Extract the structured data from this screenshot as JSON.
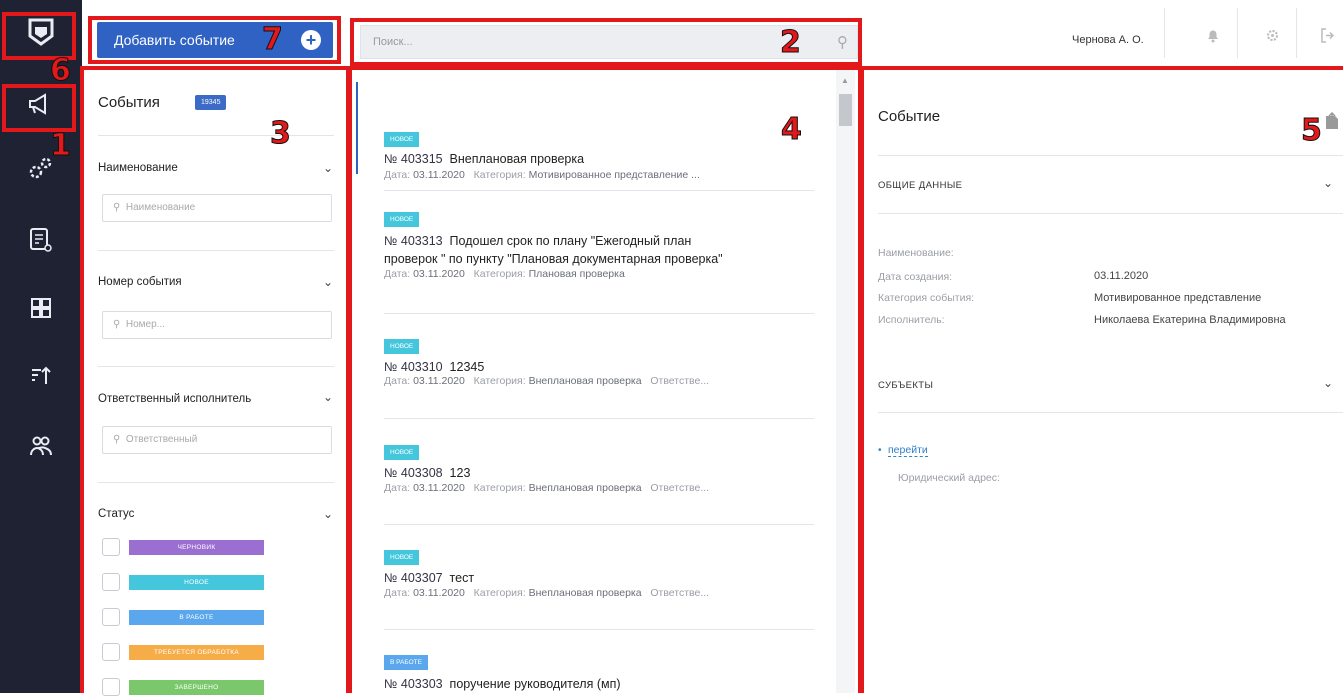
{
  "header": {
    "add_event_label": "Добавить событие",
    "search_placeholder": "Поиск...",
    "user_name": "Чернова А. О."
  },
  "sidebar": {
    "icons": [
      "logo-icon",
      "megaphone-icon",
      "gears-icon",
      "report-icon",
      "grid-icon",
      "sort-icon",
      "users-icon"
    ]
  },
  "filters": {
    "title": "События",
    "count": "19345",
    "name_label": "Наименование",
    "name_placeholder": "Наименование",
    "number_label": "Номер события",
    "number_placeholder": "Номер...",
    "responsible_label": "Ответственный исполнитель",
    "responsible_placeholder": "Ответственный",
    "status_label": "Статус",
    "statuses": [
      {
        "label": "ЧЕРНОВИК",
        "color": "#9b6fd1"
      },
      {
        "label": "НОВОЕ",
        "color": "#44c7dc"
      },
      {
        "label": "В РАБОТЕ",
        "color": "#5aa7ee"
      },
      {
        "label": "ТРЕБУЕТСЯ ОБРАБОТКА",
        "color": "#f6ad47"
      },
      {
        "label": "ЗАВЕРШЕНО",
        "color": "#7bc86c"
      }
    ]
  },
  "events": [
    {
      "badge": "НОВОЕ",
      "badge_color": "#44c7dc",
      "number": "№ 403315",
      "title": "Внеплановая проверка",
      "title2": "",
      "date_label": "Дата:",
      "date": "03.11.2020",
      "cat_label": "Категория:",
      "category": "Мотивированное представление ...",
      "extra": ""
    },
    {
      "badge": "НОВОЕ",
      "badge_color": "#44c7dc",
      "number": "№ 403313",
      "title": "Подошел срок по плану \"Ежегодный план",
      "title2": "проверок \" по пункту \"Плановая документарная проверка\"",
      "date_label": "Дата:",
      "date": "03.11.2020",
      "cat_label": "Категория:",
      "category": "Плановая проверка",
      "extra": ""
    },
    {
      "badge": "НОВОЕ",
      "badge_color": "#44c7dc",
      "number": "№ 403310",
      "title": "12345",
      "title2": "",
      "date_label": "Дата:",
      "date": "03.11.2020",
      "cat_label": "Категория:",
      "category": "Внеплановая проверка",
      "extra": "Ответстве..."
    },
    {
      "badge": "НОВОЕ",
      "badge_color": "#44c7dc",
      "number": "№ 403308",
      "title": "123",
      "title2": "",
      "date_label": "Дата:",
      "date": "03.11.2020",
      "cat_label": "Категория:",
      "category": "Внеплановая проверка",
      "extra": "Ответстве..."
    },
    {
      "badge": "НОВОЕ",
      "badge_color": "#44c7dc",
      "number": "№ 403307",
      "title": "тест",
      "title2": "",
      "date_label": "Дата:",
      "date": "03.11.2020",
      "cat_label": "Категория:",
      "category": "Внеплановая проверка",
      "extra": "Ответстве..."
    },
    {
      "badge": "В РАБОТЕ",
      "badge_color": "#5aa7ee",
      "number": "№ 403303",
      "title": "поручение руководителя (мп)",
      "title2": "",
      "date_label": "",
      "date": "",
      "cat_label": "",
      "category": "",
      "extra": ""
    }
  ],
  "detail": {
    "title": "Событие",
    "general_section": "ОБЩИЕ ДАННЫЕ",
    "fields": [
      {
        "label": "Наименование:",
        "value": ""
      },
      {
        "label": "Дата создания:",
        "value": "03.11.2020"
      },
      {
        "label": "Категория события:",
        "value": "Мотивированное представление"
      },
      {
        "label": "Исполнитель:",
        "value": "Николаева Екатерина Владимировна"
      }
    ],
    "subjects_section": "СУБЪЕКТЫ",
    "link_label": "перейти",
    "address_label": "Юридический адрес:"
  },
  "callouts": [
    "1",
    "2",
    "3",
    "4",
    "5",
    "6",
    "7"
  ]
}
